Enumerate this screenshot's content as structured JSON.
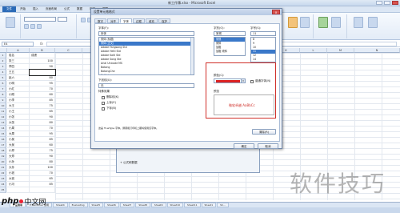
{
  "window": {
    "title": "新工作簿.xlsx - Microsoft Excel"
  },
  "menubar": {
    "file": "文件",
    "tabs": [
      "开始",
      "插入",
      "页面布局",
      "公式",
      "数据",
      "审阅",
      "视图"
    ]
  },
  "formula": {
    "namebox": "E4",
    "fx": "fx"
  },
  "columns": [
    "A",
    "B",
    "C",
    "D",
    "E",
    "F",
    "G",
    "H",
    "I",
    "J",
    "K",
    "L",
    "M",
    "N"
  ],
  "rows": [
    {
      "n": "1",
      "a": "姓名",
      "b": "成绩"
    },
    {
      "n": "2",
      "a": "张三",
      "b": "100"
    },
    {
      "n": "3",
      "a": "李四",
      "b": "90"
    },
    {
      "n": "4",
      "a": "王五",
      "b": ""
    },
    {
      "n": "5",
      "a": "赵六",
      "b": "80"
    },
    {
      "n": "6",
      "a": "小明",
      "b": "95"
    },
    {
      "n": "7",
      "a": "小红",
      "b": "70"
    },
    {
      "n": "8",
      "a": "小刚",
      "b": "60"
    },
    {
      "n": "9",
      "a": "小李",
      "b": "85"
    },
    {
      "n": "10",
      "a": "大王",
      "b": "75"
    },
    {
      "n": "11",
      "a": "小王",
      "b": "65"
    },
    {
      "n": "12",
      "a": "小张",
      "b": "90"
    },
    {
      "n": "13",
      "a": "大张",
      "b": "80"
    },
    {
      "n": "14",
      "a": "小周",
      "b": "70"
    },
    {
      "n": "15",
      "a": "大周",
      "b": "95"
    },
    {
      "n": "16",
      "a": "小吴",
      "b": "85"
    },
    {
      "n": "17",
      "a": "大吴",
      "b": "60"
    },
    {
      "n": "18",
      "a": "小郑",
      "b": "75"
    },
    {
      "n": "19",
      "a": "大郑",
      "b": "90"
    },
    {
      "n": "20",
      "a": "小孙",
      "b": "80"
    },
    {
      "n": "21",
      "a": "大孙",
      "b": "100"
    },
    {
      "n": "22",
      "a": "小钱",
      "b": "70"
    },
    {
      "n": "23",
      "a": "大钱",
      "b": "65"
    },
    {
      "n": "24",
      "a": "小冯",
      "b": "85"
    },
    {
      "n": "25",
      "a": "",
      "b": ""
    }
  ],
  "dialog": {
    "title": "设置单元格格式",
    "close": "x",
    "tabs": [
      "数字",
      "对齐",
      "字体",
      "边框",
      "填充",
      "保护"
    ],
    "active_tab": 2,
    "font_label": "字体(F):",
    "font_value": "宋体",
    "fonts": [
      "宋体 (标题)",
      "宋体 (正文)",
      "Adobe Fangsong Std",
      "Adobe Heiti Std",
      "Adobe Kaiti Std",
      "Adobe Song Std",
      "Arial Unicode MS",
      "Batang",
      "BatangChe",
      "Calibri",
      "Cambria"
    ],
    "style_label": "字形(O):",
    "style_value": "常规",
    "styles": [
      "常规",
      "倾斜",
      "加粗",
      "加粗 倾斜"
    ],
    "size_label": "字号(S):",
    "size_value": "11",
    "sizes": [
      "8",
      "9",
      "10",
      "11",
      "12",
      "14"
    ],
    "underline_label": "下划线(U):",
    "underline_value": "无",
    "color_label": "颜色(C):",
    "normal_font": "普通字体(N)",
    "effects_label": "特殊效果",
    "effects": [
      "删除线(K)",
      "上标(E)",
      "下标(B)"
    ],
    "preview_label": "预览",
    "preview_text": "微软卓越 AaBbCc",
    "note": "这是 TrueType 字体。屏幕和打印机上都将使用该字体。",
    "clear_button": "清除(R)",
    "ok_button": "确定",
    "cancel_button": "取消"
  },
  "back_dialog": {
    "row_label": "+ 公式和数据"
  },
  "sheets": [
    "产品清单",
    "Freemarker 说明",
    "Sheet4",
    "Evaluating",
    "Sheet5",
    "Sheet6",
    "Sheet7",
    "Sheet8",
    "Sheet9",
    "Sheet10",
    "Sheet11",
    "Sheet1",
    "Sh..."
  ],
  "watermarks": {
    "left_php": "php",
    "left_cn": "中文网",
    "right": "软件技巧"
  },
  "colors": {
    "accent": "#2c6bb7",
    "highlight": "#d0302a"
  }
}
